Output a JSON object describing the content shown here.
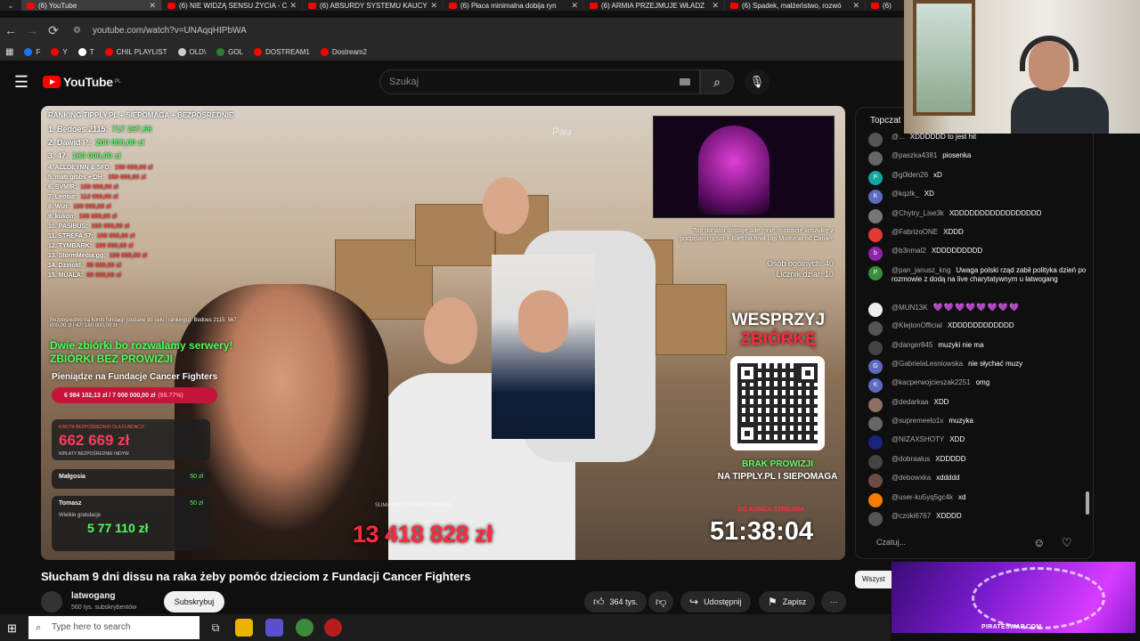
{
  "browser": {
    "tabs": [
      {
        "title": "(6) YouTube",
        "active": true
      },
      {
        "title": "(6) NIE WIDZĄ SENSU ŻYCIA - C",
        "active": false
      },
      {
        "title": "(6) ABSURDY SYSTEMU KAUCY",
        "active": false
      },
      {
        "title": "(6) Płaca minimalna dobija ryn",
        "active": false
      },
      {
        "title": "(6) ARMIA PRZEJMUJE WŁADZ",
        "active": false
      },
      {
        "title": "(6) Spadek, małżeństwo, rozwó",
        "active": false
      },
      {
        "title": "(6)",
        "active": false
      }
    ],
    "url": "youtube.com/watch?v=UNAqqHIPbWA",
    "bookmarks": [
      "F",
      "Y",
      "T",
      "CHIL PLAYLIST",
      "OLD\\",
      "GOL",
      "DOSTREAM1",
      "Dostream2"
    ]
  },
  "youtube": {
    "logo": "YouTube",
    "region": "PL",
    "search_placeholder": "Szukaj"
  },
  "video": {
    "ranking_title": "RANKING TIPPLY.PL + SIEPOMAGA + BEZPOŚREDNIE",
    "ranking": [
      {
        "name": "1. Bedoes 2115:",
        "value": "717 267,66"
      },
      {
        "name": "2. Dawid P.:",
        "value": "200 000,00 zł"
      },
      {
        "name": "3. 47:",
        "value": "180 000,00 zł"
      },
      {
        "name": "4. ALLDEYNN & SFD:",
        "value": "150 000,00 zł"
      },
      {
        "name": "5. mati gibbs + DH:",
        "value": "150 000,00 zł"
      },
      {
        "name": "6. SVMIR:",
        "value": "150 000,00 zł"
      },
      {
        "name": "7. Leosia:",
        "value": "112 000,00 zł"
      },
      {
        "name": "8. Wizi:",
        "value": "100 000,00 zł"
      },
      {
        "name": "9. kukon:",
        "value": "100 000,00 zł"
      },
      {
        "name": "10. PASIBUS:",
        "value": "100 000,00 zł"
      },
      {
        "name": "11. STREFA 57:",
        "value": "100 000,00 zł"
      },
      {
        "name": "12. TYMBARK:",
        "value": "100 000,00 zł"
      },
      {
        "name": "13. StormMedia.gg:",
        "value": "100 000,00 zł"
      },
      {
        "name": "14. Dzinold:",
        "value": "95 000,00 zł"
      },
      {
        "name": "15. MUALA:",
        "value": "80 000,00 zł"
      }
    ],
    "fund_note": "Bezpośrednio na konto fundacji (dodane do celu i rankingu): Bedoes 2115: 567 000,00 zł i 47: 180 000,00 zł",
    "green_line_1": "Dwie zbiórki bo rozwalamy serwery!",
    "green_line_2": "ZBIÓRKI BEZ PROWIZJI",
    "fundacja_label": "Pieniądze na Fundacje Cancer Fighters",
    "fundacja_progress": "6 984 102,13 zł / 7 000 000,00 zł",
    "fundacja_percent": "(99.77%)",
    "fundacja_percent_value": 99.77,
    "fund_box_label": "KWOTA BEZPOŚREDNIO DLA FUNDACJI",
    "fund_box_amount": "662 669 zł",
    "fund_box_sub": "WPŁATY BEZPOŚREDNIE INDYW.",
    "donors": [
      {
        "name": "Małgosia",
        "amount": "50 zł",
        "message": ""
      },
      {
        "name": "Tomasz",
        "amount": "50 zł",
        "message": "Wielkie gratulacje"
      }
    ],
    "donor_big_amount": "5 77  110 zł",
    "center_label": "SUMA WSZYSTKICH ZBIÓREK",
    "big_total": "13 418 828 zł",
    "pau_label": "Pau",
    "top_donator": "Top donator dostaje ode mnie osobiście koszulkę z podpisami gości + Bilet na finał Ligi Mistrzów od Canal+",
    "stats": [
      "Osób ogólnych: 40",
      "Licznik dziar: 10"
    ],
    "wesprzyj_1": "WESPRZYJ",
    "wesprzyj_2": "ZBIÓRKĘ",
    "brak_1": "BRAK PROWIZJI",
    "brak_2": "NA TIPPLY.PL I SIEPOMAGA",
    "do_konca": "DO KOŃCA STREAMA",
    "timer": "51:38:04"
  },
  "meta": {
    "title": "Słucham 9 dni dissu na raka żeby pomóc dzieciom z Fundacji Cancer Fighters",
    "channel": "latwogang",
    "subscribers": "560 tys. subskrybentów",
    "subscribe_label": "Subskrybuj",
    "likes": "364 tys.",
    "share_label": "Udostępnij",
    "save_label": "Zapisz"
  },
  "chat": {
    "header": "Topczat",
    "input_placeholder": "Czatuj...",
    "filter_label": "Wszyst",
    "messages": [
      {
        "author": "@...",
        "text": "XDDDDDD to jest hit",
        "color": "#555"
      },
      {
        "author": "@paszka4381",
        "text": "piosenka",
        "color": "#666"
      },
      {
        "author": "@g0lden26",
        "text": "xD",
        "color": "#12a79d",
        "initial": "P"
      },
      {
        "author": "@kqzlk_",
        "text": "XD",
        "color": "#5c6bc0",
        "initial": "K"
      },
      {
        "author": "@Chytry_Lise3k",
        "text": "XDDDDDDDDDDDDDDDDD",
        "color": "#777"
      },
      {
        "author": "@FabrizoONE",
        "text": "XDDD",
        "color": "#e53935"
      },
      {
        "author": "@b3nmal2",
        "text": "XDDDDDDDDD",
        "color": "#8e24aa",
        "initial": "b"
      },
      {
        "author": "@pan_janusz_kng",
        "text": "Uwaga polski rząd zabił polityka dzień po rozmowie z dodą na live charytatywnym u łatwogang",
        "color": "#388e3c",
        "initial": "P"
      },
      {
        "author": "@MUN13K",
        "text": "💜💜💜💜💜💜💜💜",
        "color": "#eee",
        "purple": true
      },
      {
        "author": "@KlejtonOfficial",
        "text": "XDDDDDDDDDDDD",
        "color": "#555"
      },
      {
        "author": "@danger845",
        "text": "muzyki nie ma",
        "color": "#444"
      },
      {
        "author": "@GabrielaLesniowska",
        "text": "nie słychać muzy",
        "color": "#5c6bc0",
        "initial": "G"
      },
      {
        "author": "@kacperwojcieszak2251",
        "text": "omg",
        "color": "#5c6bc0",
        "initial": "K"
      },
      {
        "author": "@dedarkaa",
        "text": "XDD",
        "color": "#8d6e63"
      },
      {
        "author": "@supremeelo1x",
        "text": "muzyka",
        "color": "#666"
      },
      {
        "author": "@NIZAXSHOTY",
        "text": "XDD",
        "color": "#1a237e"
      },
      {
        "author": "@dobraalus",
        "text": "XDDDDD",
        "color": "#444"
      },
      {
        "author": "@debowxka",
        "text": "xddddd",
        "color": "#6d4c41"
      },
      {
        "author": "@user-ku5yq5gc4k",
        "text": "xd",
        "color": "#f57c00"
      },
      {
        "author": "@czoki6767",
        "text": "XDDDD",
        "color": "#555"
      }
    ]
  },
  "promo": {
    "text": "PIRATESWAP.COM"
  },
  "taskbar": {
    "search_placeholder": "Type here to search"
  }
}
